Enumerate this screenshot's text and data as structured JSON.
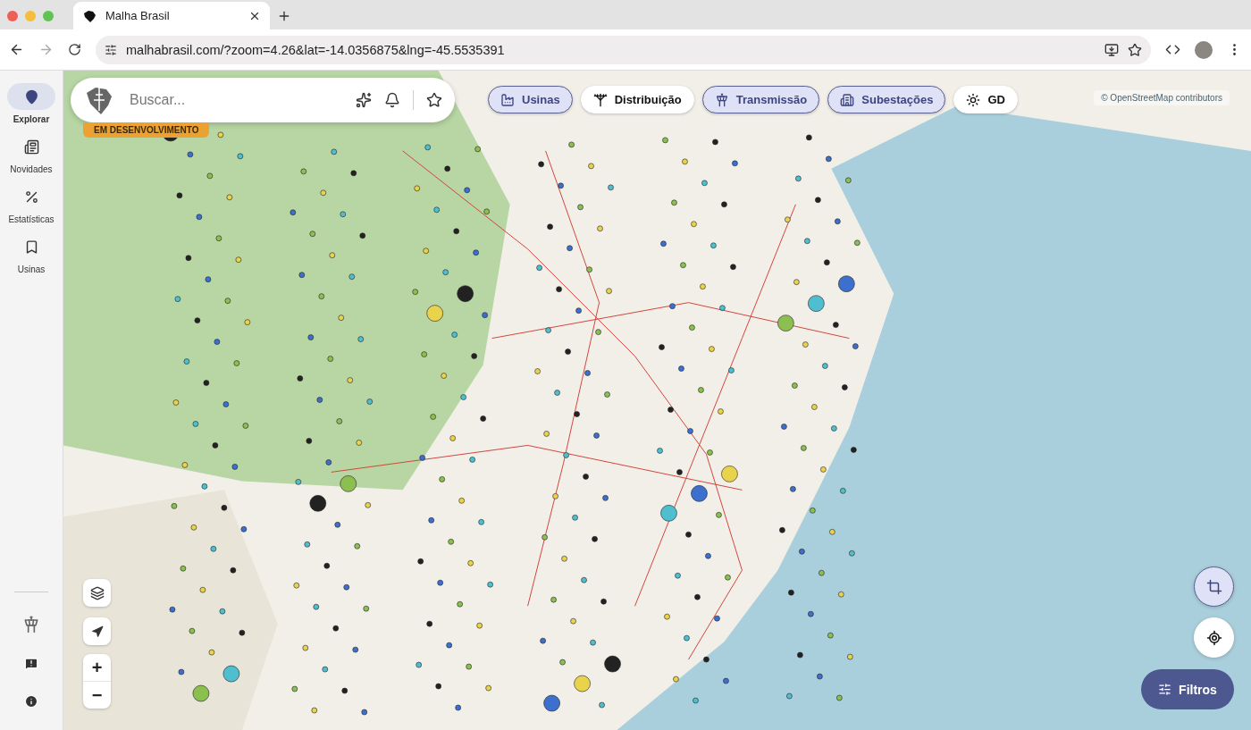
{
  "browser": {
    "tab_title": "Malha Brasil",
    "url": "malhabrasil.com/?zoom=4.26&lat=-14.0356875&lng=-45.5535391"
  },
  "sidebar": {
    "items": [
      {
        "label": "Explorar",
        "selected": true
      },
      {
        "label": "Novidades",
        "selected": false
      },
      {
        "label": "Estatísticas",
        "selected": false
      },
      {
        "label": "Usinas",
        "selected": false
      }
    ]
  },
  "search": {
    "placeholder": "Buscar...",
    "badge": "EM DESENVOLVIMENTO"
  },
  "layer_chips": [
    {
      "label": "Usinas",
      "selected": true
    },
    {
      "label": "Distribuição",
      "selected": false
    },
    {
      "label": "Transmissão",
      "selected": true
    },
    {
      "label": "Subestações",
      "selected": true
    },
    {
      "label": "GD",
      "selected": false
    }
  ],
  "map": {
    "attribution": "© OpenStreetMap contributors"
  },
  "zoom_controls": {
    "zoom_in": "+",
    "zoom_out": "−"
  },
  "filters_button": {
    "label": "Filtros"
  }
}
